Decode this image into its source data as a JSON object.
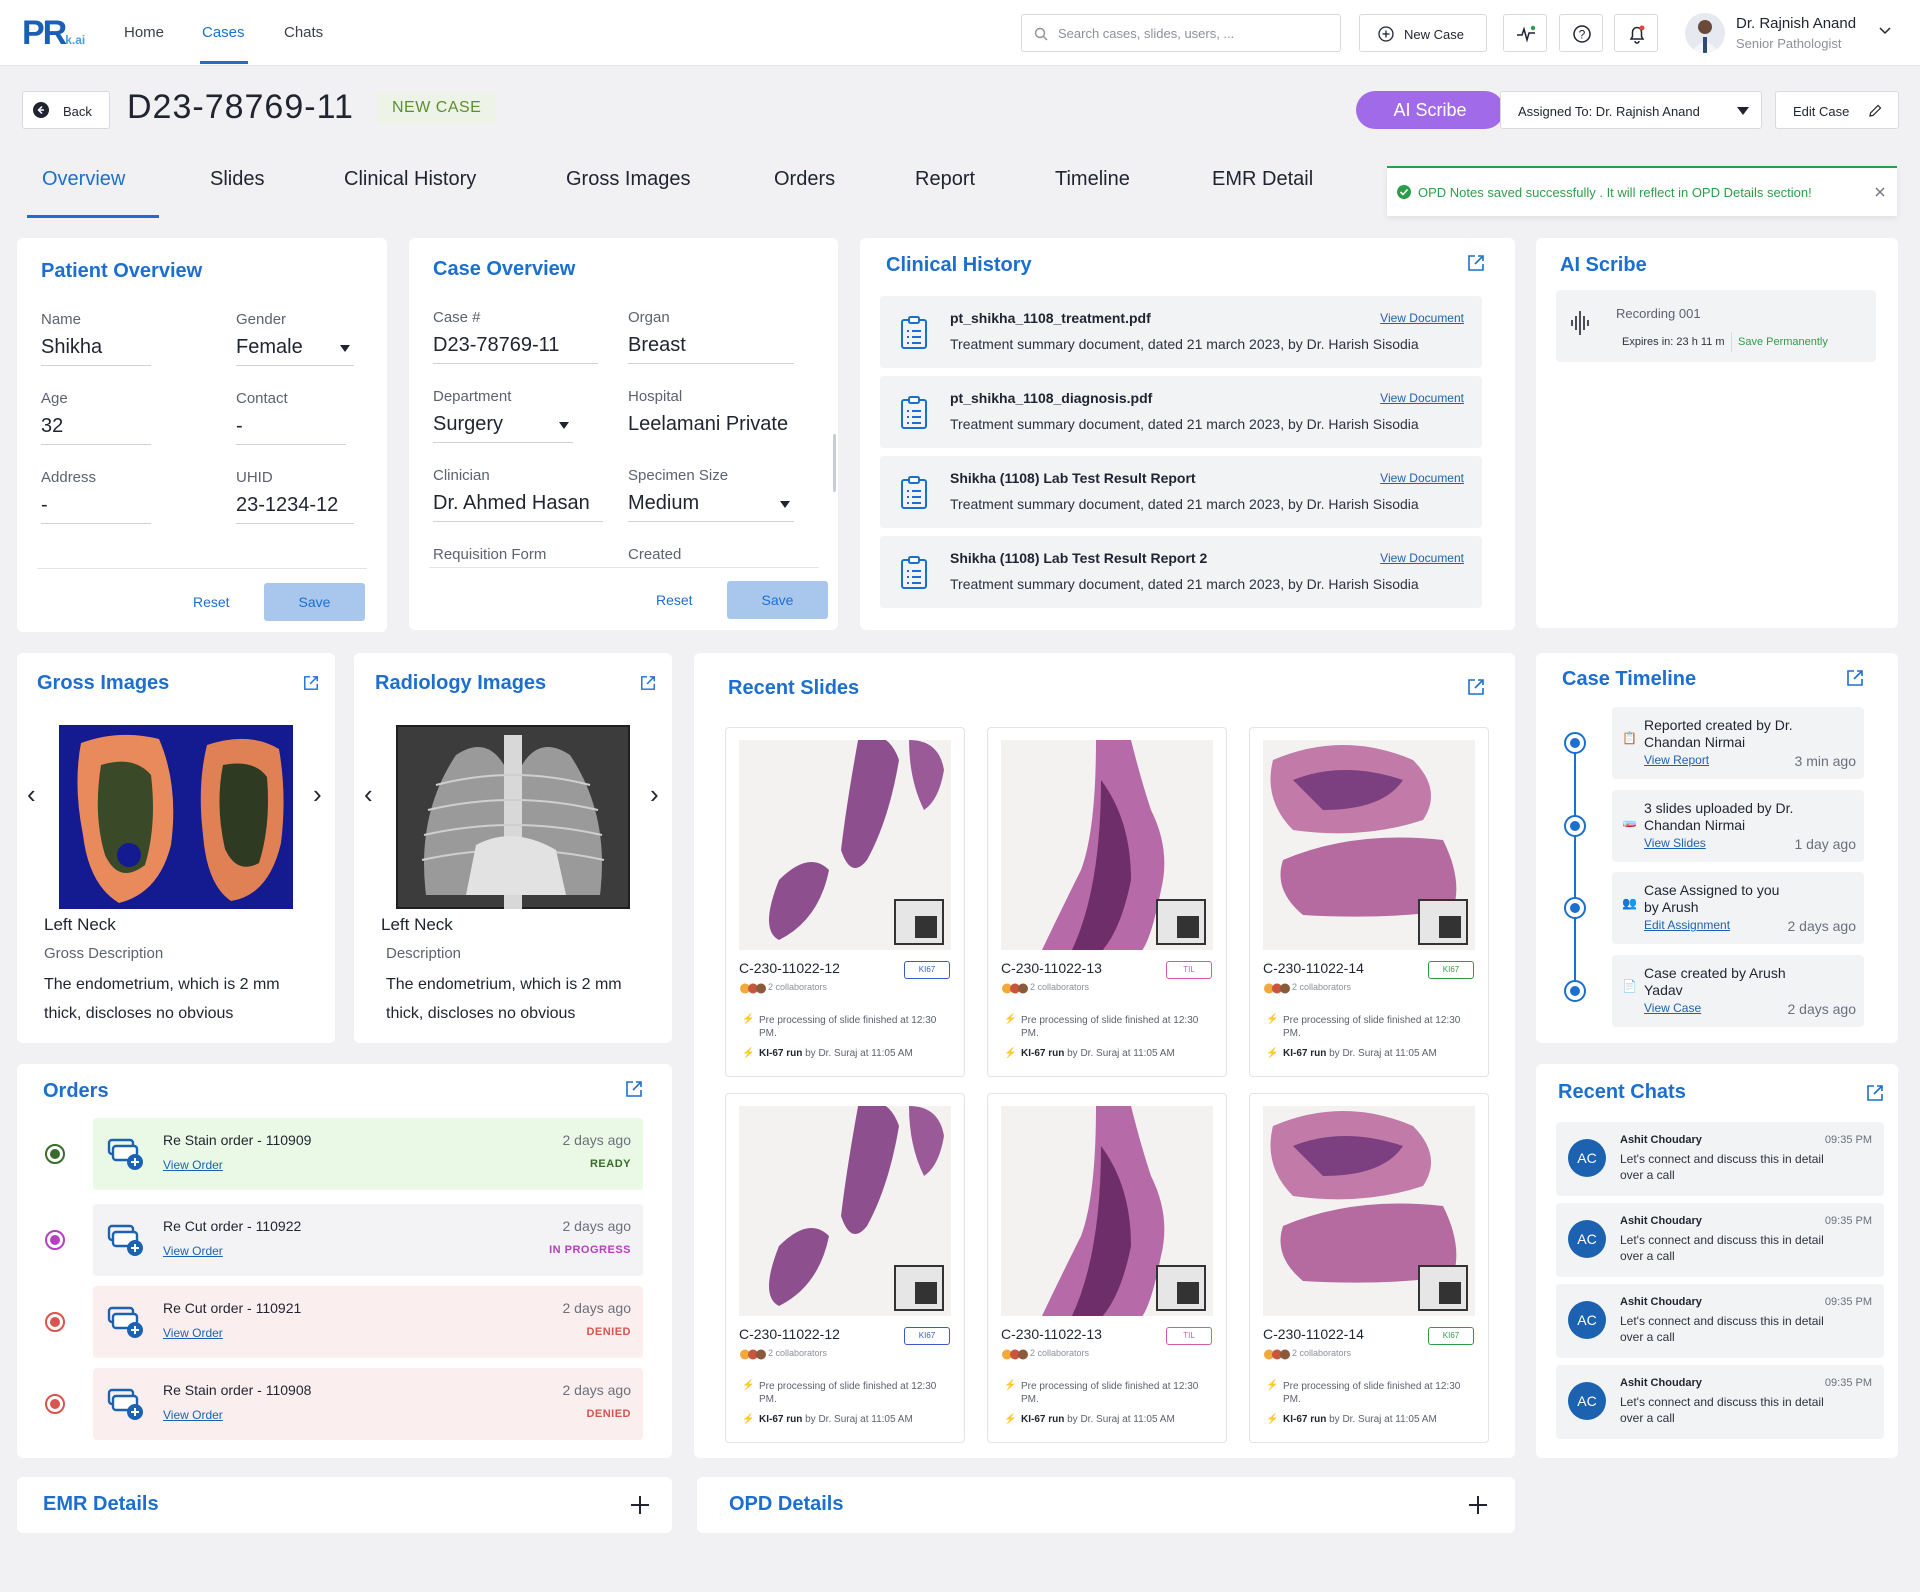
{
  "app": {
    "logo": "PR",
    "logo_sub": "k.ai"
  },
  "nav": {
    "home": "Home",
    "cases": "Cases",
    "chats": "Chats",
    "search_placeholder": "Search cases, slides, users, ...",
    "new_case": "New Case",
    "user_name": "Dr. Rajnish Anand",
    "user_role": "Senior Pathologist"
  },
  "header": {
    "back": "Back",
    "case_number": "D23-78769-11",
    "status": "NEW CASE",
    "ai_scribe": "AI Scribe",
    "assigned_label": "Assigned To: Dr. Rajnish Anand",
    "edit_case": "Edit Case"
  },
  "tabs": [
    "Overview",
    "Slides",
    "Clinical History",
    "Gross Images",
    "Orders",
    "Report",
    "Timeline",
    "EMR Detail"
  ],
  "toast": {
    "message": "OPD Notes saved successfully . It will reflect in OPD Details section!"
  },
  "patient": {
    "title": "Patient Overview",
    "name_label": "Name",
    "name": "Shikha",
    "gender_label": "Gender",
    "gender": "Female",
    "age_label": "Age",
    "age": "32",
    "contact_label": "Contact",
    "contact": "-",
    "address_label": "Address",
    "address": "-",
    "uhid_label": "UHID",
    "uhid": "23-1234-12",
    "reset": "Reset",
    "save": "Save"
  },
  "case": {
    "title": "Case Overview",
    "case_label": "Case #",
    "case_no": "D23-78769-11",
    "organ_label": "Organ",
    "organ": "Breast",
    "dept_label": "Department",
    "dept": "Surgery",
    "hospital_label": "Hospital",
    "hospital": "Leelamani Private",
    "clinician_label": "Clinician",
    "clinician": "Dr. Ahmed Hasan",
    "specimen_label": "Specimen Size",
    "specimen": "Medium",
    "req_label": "Requisition Form",
    "created_label": "Created",
    "reset": "Reset",
    "save": "Save"
  },
  "clinical": {
    "title": "Clinical History",
    "link": "View Document",
    "docs": [
      {
        "name": "pt_shikha_1108_treatment.pdf",
        "desc": "Treatment summary document, dated 21 march 2023, by Dr. Harish Sisodia"
      },
      {
        "name": "pt_shikha_1108_diagnosis.pdf",
        "desc": "Treatment summary document, dated 21 march 2023, by Dr. Harish Sisodia"
      },
      {
        "name": "Shikha (1108) Lab Test Result Report",
        "desc": "Treatment summary document, dated 21 march 2023, by Dr. Harish Sisodia"
      },
      {
        "name": "Shikha (1108) Lab Test Result Report 2",
        "desc": "Treatment summary document, dated 21 march 2023, by Dr. Harish Sisodia"
      }
    ]
  },
  "aiscribe": {
    "title": "AI Scribe",
    "recording": "Recording 001",
    "expires": "Expires in: 23 h 11 m",
    "save_perm": "Save Permanently"
  },
  "gross": {
    "title": "Gross Images",
    "site": "Left Neck",
    "desc_label": "Gross Description",
    "desc": "The endometrium, which is 2 mm thick, discloses no obvious"
  },
  "radiology": {
    "title": "Radiology Images",
    "site": "Left Neck",
    "desc_label": "Description",
    "desc": "The endometrium, which is 2 mm thick, discloses no obvious"
  },
  "slides": {
    "title": "Recent Slides",
    "collaborators": "2 collaborators",
    "line1": "Pre processing of slide finished at 12:30 PM.",
    "line2_bold": "KI-67 run",
    "line2": "by Dr. Suraj at 11:05 AM",
    "items": [
      {
        "id": "C-230-11022-12",
        "badge": "KI67",
        "color": "#3b5bc9"
      },
      {
        "id": "C-230-11022-13",
        "badge": "TIL",
        "color": "#d65aa8"
      },
      {
        "id": "C-230-11022-14",
        "badge": "KI67",
        "color": "#2e9d4a"
      },
      {
        "id": "C-230-11022-12",
        "badge": "KI67",
        "color": "#3b5bc9"
      },
      {
        "id": "C-230-11022-13",
        "badge": "TIL",
        "color": "#d65aa8"
      },
      {
        "id": "C-230-11022-14",
        "badge": "KI67",
        "color": "#2e9d4a"
      }
    ]
  },
  "timeline": {
    "title": "Case Timeline",
    "items": [
      {
        "text": "Reported created by Dr. Chandan Nirmai",
        "link": "View Report",
        "ago": "3 min ago"
      },
      {
        "text": "3 slides uploaded by Dr. Chandan Nirmai",
        "link": "View Slides",
        "ago": "1 day ago"
      },
      {
        "text": "Case Assigned to you by Arush",
        "link": "Edit Assignment",
        "ago": "2 days ago"
      },
      {
        "text": "Case created by Arush Yadav",
        "link": "View Case",
        "ago": "2 days ago"
      }
    ]
  },
  "orders": {
    "title": "Orders",
    "link": "View Order",
    "items": [
      {
        "name": "Re Stain order - 110909",
        "ago": "2 days ago",
        "status": "READY",
        "color": "#3a6b2a",
        "bg": "#eaf9e6"
      },
      {
        "name": "Re Cut order - 110922",
        "ago": "2 days ago",
        "status": "IN PROGRESS",
        "color": "#b53fbf",
        "bg": "#f3f3f5"
      },
      {
        "name": "Re Cut order - 110921",
        "ago": "2 days ago",
        "status": "DENIED",
        "color": "#d9534f",
        "bg": "#fbeeee"
      },
      {
        "name": "Re Stain order - 110908",
        "ago": "2 days ago",
        "status": "DENIED",
        "color": "#d9534f",
        "bg": "#fbeeee"
      }
    ]
  },
  "chats": {
    "title": "Recent Chats",
    "items": [
      {
        "initials": "AC",
        "name": "Ashit Choudary",
        "time": "09:35 PM",
        "msg": "Let's connect and discuss this in detail over a call"
      },
      {
        "initials": "AC",
        "name": "Ashit Choudary",
        "time": "09:35 PM",
        "msg": "Let's connect and discuss this in detail over a call"
      },
      {
        "initials": "AC",
        "name": "Ashit Choudary",
        "time": "09:35 PM",
        "msg": "Let's connect and discuss this in detail over a call"
      },
      {
        "initials": "AC",
        "name": "Ashit Choudary",
        "time": "09:35 PM",
        "msg": "Let's connect and discuss this in detail over a call"
      }
    ]
  },
  "emr": {
    "title": "EMR Details"
  },
  "opd": {
    "title": "OPD Details"
  }
}
